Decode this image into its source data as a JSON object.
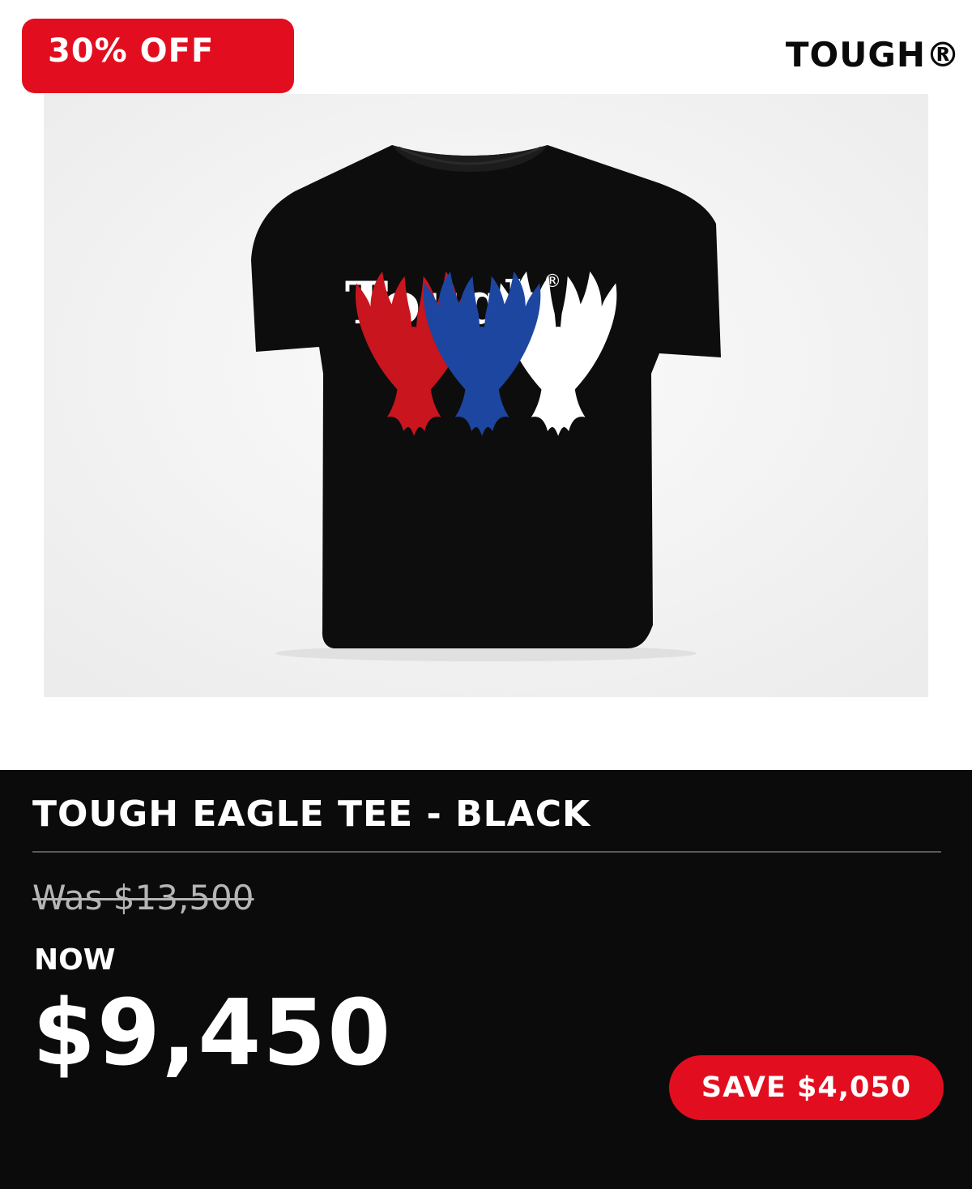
{
  "promo": {
    "discount_label": "30% OFF"
  },
  "brand": {
    "name": "TOUGH®"
  },
  "product_image": {
    "print_text": "Tough®",
    "eagle_colors": [
      "#c8151e",
      "#1c46a0",
      "#ffffff"
    ],
    "shirt_color": "#0d0d0d"
  },
  "product": {
    "title": "TOUGH EAGLE TEE - BLACK",
    "was_price": "Was $13,500",
    "now_label": "NOW",
    "now_price": "$9,450",
    "save_label": "SAVE $4,050"
  },
  "colors": {
    "accent_red": "#e20e1f",
    "panel_bg": "#0b0b0c",
    "text_white": "#ffffff",
    "muted_text": "#b5b5b5"
  }
}
